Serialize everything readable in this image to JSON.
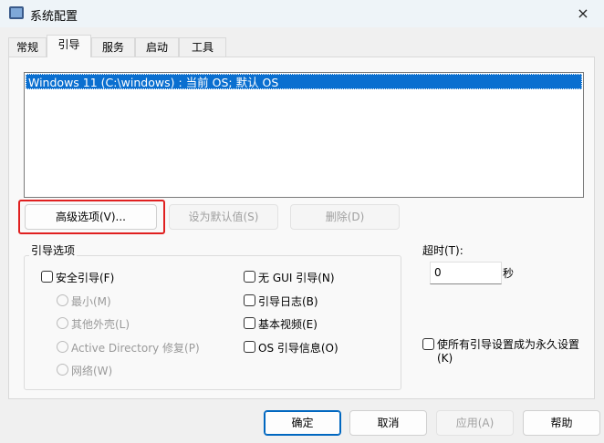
{
  "window": {
    "title": "系统配置",
    "close_icon": "×"
  },
  "tabs": [
    "常规",
    "引导",
    "服务",
    "启动",
    "工具"
  ],
  "active_tab": "引导",
  "boot_list": [
    "Windows 11 (C:\\windows) : 当前 OS; 默认 OS"
  ],
  "buttons": {
    "advanced": "高级选项(V)...",
    "set_default": "设为默认值(S)",
    "delete": "删除(D)"
  },
  "boot_options": {
    "label": "引导选项",
    "safe_boot": "安全引导(F)",
    "radios": [
      "最小(M)",
      "其他外壳(L)",
      "Active Directory 修复(P)",
      "网络(W)"
    ],
    "right": [
      "无 GUI 引导(N)",
      "引导日志(B)",
      "基本视频(E)",
      "OS 引导信息(O)"
    ]
  },
  "timeout": {
    "label": "超时(T):",
    "value": "0",
    "unit": "秒"
  },
  "permanent": {
    "line1": "使所有引导设置成为永久设置",
    "line2": "(K)"
  },
  "footer": {
    "ok": "确定",
    "cancel": "取消",
    "apply": "应用(A)",
    "help": "帮助"
  },
  "colors": {
    "selection": "#0a6fd0",
    "highlight": "#e02020"
  }
}
